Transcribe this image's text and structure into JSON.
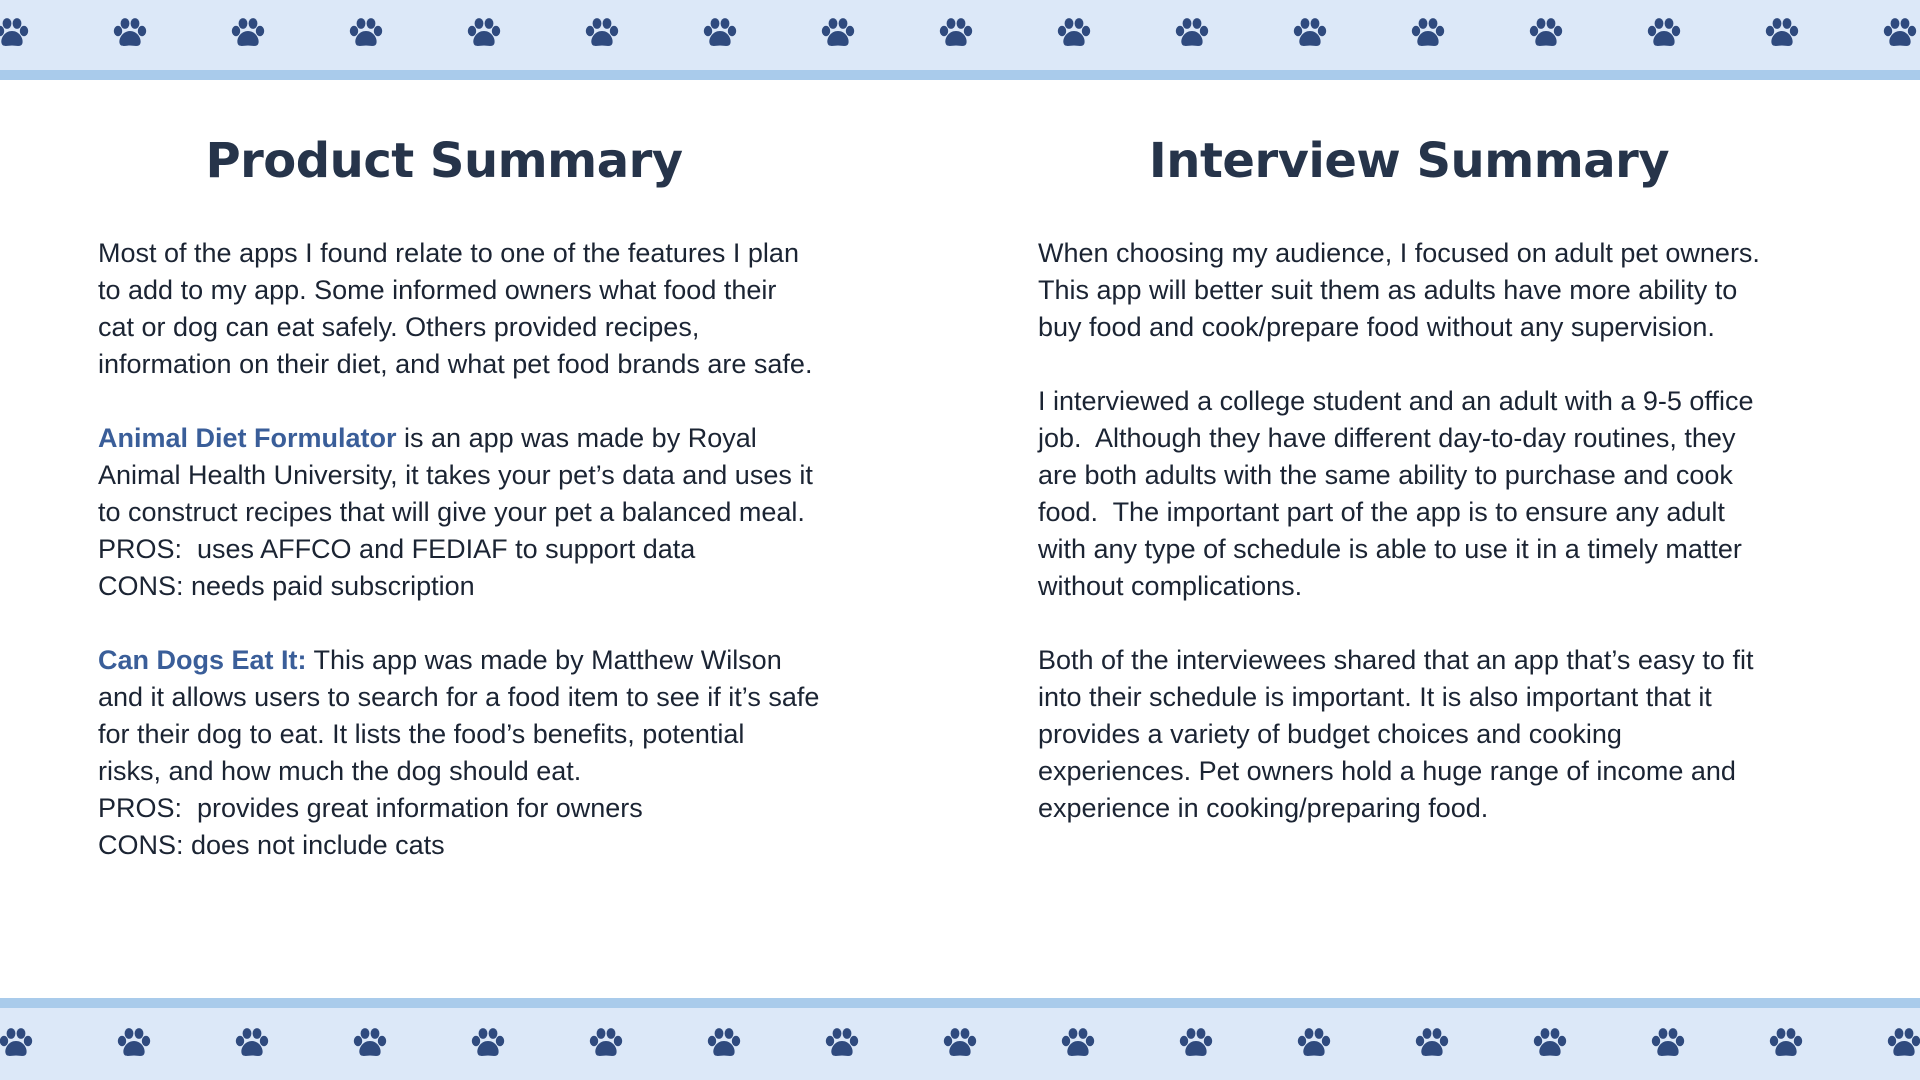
{
  "product_summary": {
    "title": "Product Summary",
    "intro": [
      "Most of the apps I found relate to one of the features I plan",
      "to add to my app. Some informed owners what food their",
      "cat or dog can eat safely. Others provided recipes,",
      "information on their diet, and what pet food brands are safe."
    ],
    "app1": {
      "name": "Animal Diet Formulator",
      "first_line_rest": " is an app was made by Royal",
      "lines": [
        "Animal Health University, it takes your pet’s data and uses it",
        "to construct recipes that will give your pet a balanced meal.",
        "PROS:  uses AFFCO and FEDIAF to support data",
        "CONS: needs paid subscription"
      ]
    },
    "app2": {
      "name": "Can Dogs Eat It:",
      "first_line_rest": " This app was made by Matthew Wilson",
      "lines": [
        "and it allows users to search for a food item to see if it’s safe",
        "for their dog to eat. It lists the food’s benefits, potential",
        "risks, and how much the dog should eat.",
        "PROS:  provides great information for owners",
        "CONS: does not include cats"
      ]
    }
  },
  "interview_summary": {
    "title": "Interview Summary",
    "paragraphs": [
      [
        "When choosing my audience, I focused on adult pet owners.",
        "This app will better suit them as adults have more ability to",
        "buy food and cook/prepare food without any supervision."
      ],
      [
        "I interviewed a college student and an adult with a 9-5 office",
        "job.  Although they have different day-to-day routines, they",
        "are both adults with the same ability to purchase and cook",
        "food.  The important part of the app is to ensure any adult",
        "with any type of schedule is able to use it in a timely matter",
        "without complications."
      ],
      [
        "Both of the interviewees shared that an app that’s easy to fit",
        "into their schedule is important. It is also important that it",
        "provides a variety of budget choices and cooking",
        "experiences. Pet owners hold a huge range of income and",
        "experience in cooking/preparing food."
      ]
    ]
  },
  "decor": {
    "paw_icon": "paw-print-icon",
    "band_color": "#dce8f8",
    "band_line_color": "#a9cbeb",
    "paw_color": "#2f4a7e",
    "title_color": "#26344a",
    "highlight_color": "#3a5e99"
  }
}
